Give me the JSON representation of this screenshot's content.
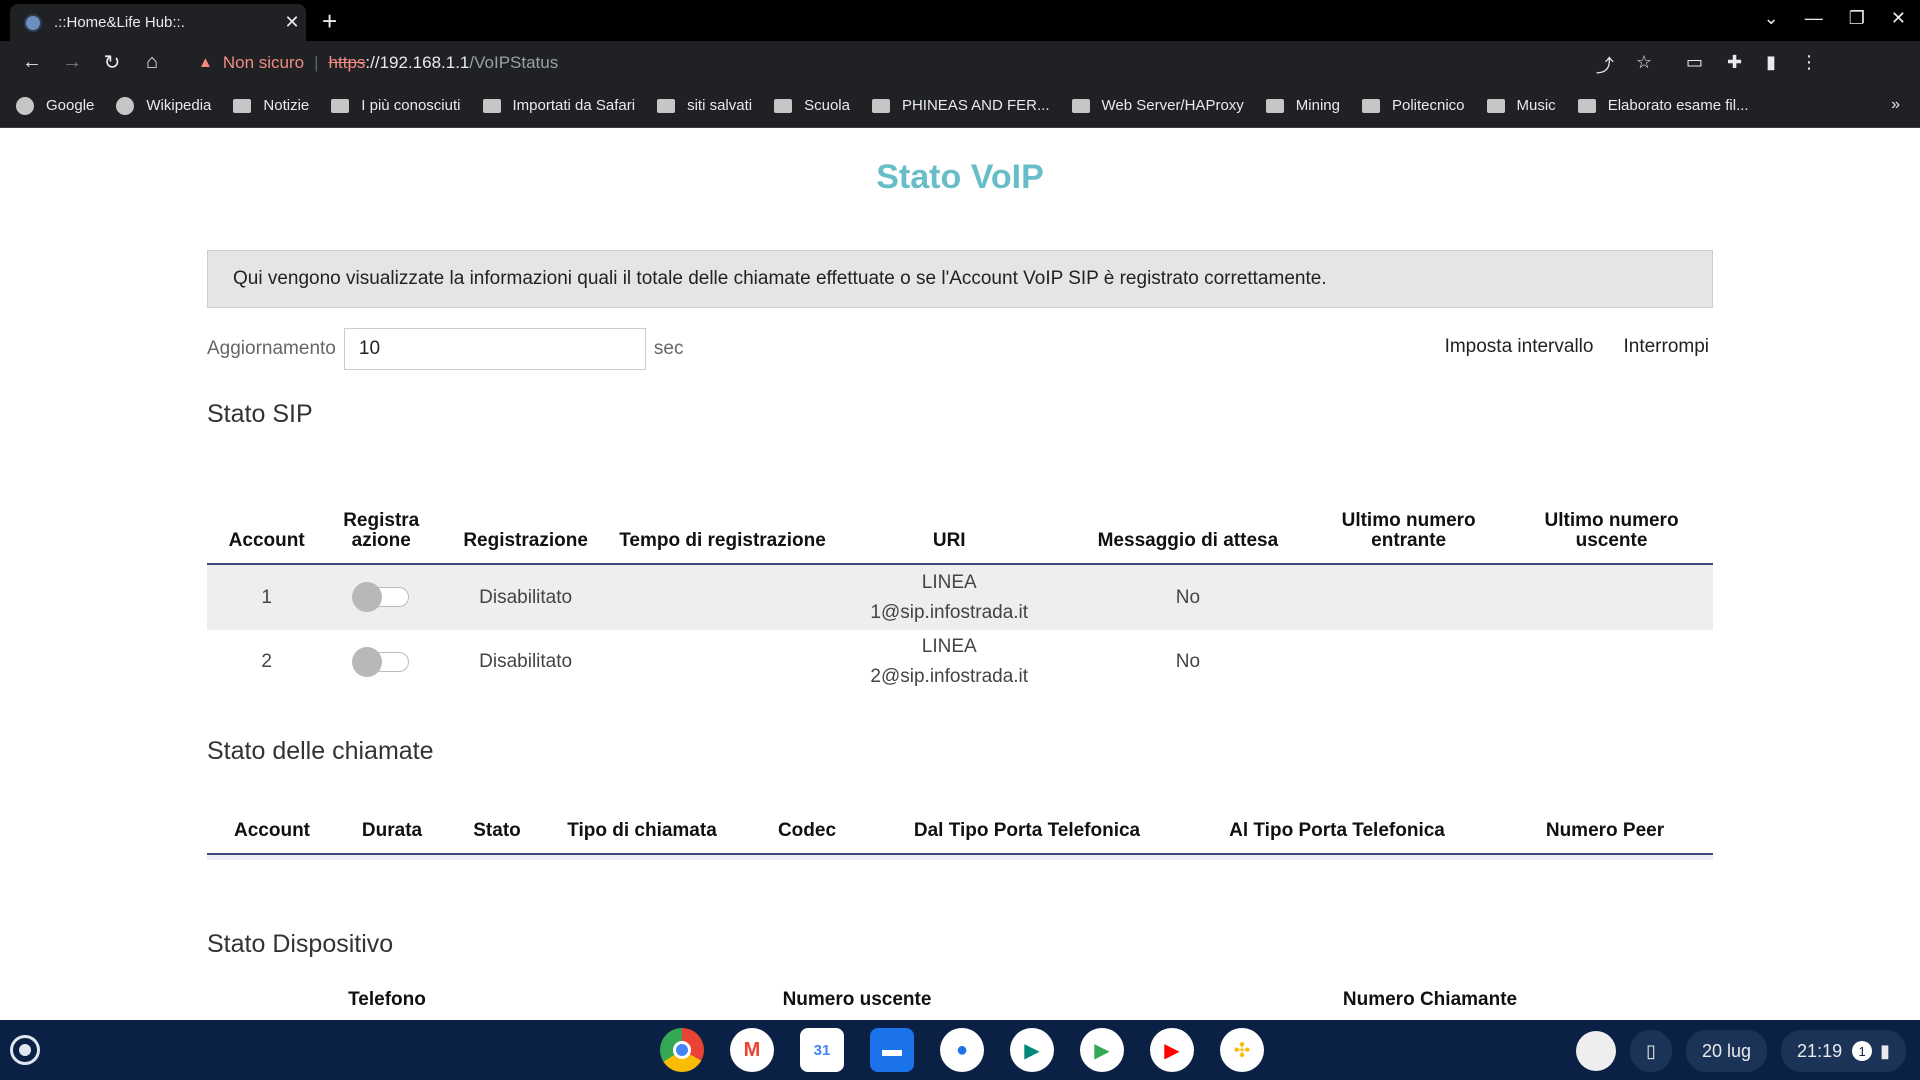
{
  "browser": {
    "tab_title": ".::Home&Life Hub::.",
    "new_tab": "+",
    "security_label": "Non sicuro",
    "url_scheme": "https",
    "url_host": "://192.168.1.1",
    "url_path": "/VoIPStatus",
    "bookmarks": [
      "Google",
      "Wikipedia",
      "Notizie",
      "I più conosciuti",
      "Importati da Safari",
      "siti salvati",
      "Scuola",
      "PHINEAS AND FER...",
      "Web Server/HAProxy",
      "Mining",
      "Politecnico",
      "Music",
      "Elaborato esame fil..."
    ],
    "bookmarks_more": "»"
  },
  "page": {
    "title": "Stato VoIP",
    "info": "Qui vengono visualizzate la informazioni quali il totale delle chiamate effettuate o se l'Account VoIP SIP è registrato correttamente.",
    "refresh_label": "Aggiornamento",
    "refresh_value": "10",
    "refresh_unit": "sec",
    "set_interval": "Imposta intervallo",
    "stop": "Interrompi"
  },
  "sip": {
    "heading": "Stato SIP",
    "headers": [
      "Account",
      "Registra azione",
      "Registrazione",
      "Tempo di registrazione",
      "URI",
      "Messaggio di attesa",
      "Ultimo numero entrante",
      "Ultimo numero uscente"
    ],
    "rows": [
      {
        "account": "1",
        "toggle_on": false,
        "registration": "Disabilitato",
        "time": "",
        "uri_1": "LINEA",
        "uri_2": "1@sip.infostrada.it",
        "mwi": "No",
        "last_in": "",
        "last_out": ""
      },
      {
        "account": "2",
        "toggle_on": false,
        "registration": "Disabilitato",
        "time": "",
        "uri_1": "LINEA",
        "uri_2": "2@sip.infostrada.it",
        "mwi": "No",
        "last_in": "",
        "last_out": ""
      }
    ]
  },
  "calls": {
    "heading": "Stato delle chiamate",
    "headers": [
      "Account",
      "Durata",
      "Stato",
      "Tipo di chiamata",
      "Codec",
      "Dal Tipo Porta Telefonica",
      "Al Tipo Porta Telefonica",
      "Numero Peer"
    ]
  },
  "device": {
    "heading": "Stato Dispositivo",
    "headers": [
      "Telefono",
      "Numero uscente",
      "Numero Chiamante"
    ]
  },
  "shelf": {
    "date": "20 lug",
    "time": "21:19",
    "notifications": "1",
    "calendar_day": "31"
  }
}
